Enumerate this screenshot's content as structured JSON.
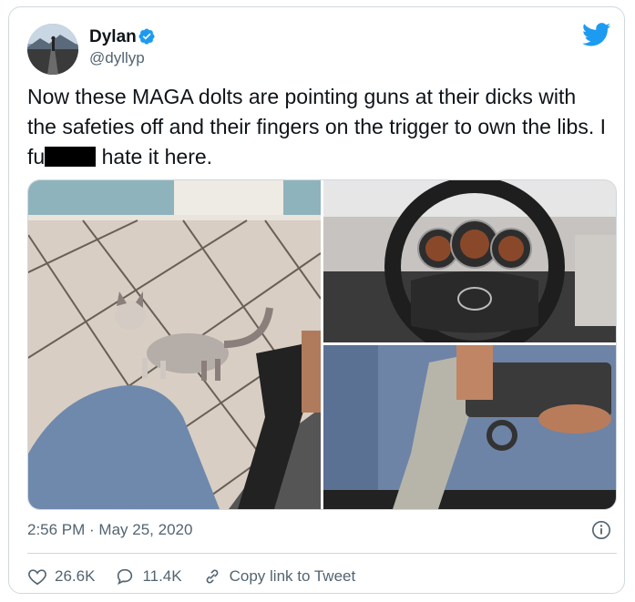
{
  "user": {
    "display_name": "Dylan",
    "handle": "@dyllyp",
    "avatar_icon": "avatar-photo",
    "verified_icon": "verified-badge-icon"
  },
  "tweet": {
    "text_part1": "Now these MAGA dolts are pointing guns at their dicks with the safeties off and their fingers on the trigger to own the libs. I fu",
    "text_part2": " hate it here.",
    "timestamp": "2:56 PM · May 25, 2020"
  },
  "media": {
    "images": [
      "cat-photo",
      "steering-wheel-photo",
      "pistol-photo"
    ]
  },
  "actions": {
    "likes": "26.6K",
    "replies": "11.4K",
    "copy_link_label": "Copy link to Tweet"
  },
  "colors": {
    "brand": "#1d9bf0",
    "text": "#0f1419",
    "muted": "#536471",
    "border": "#cfd9de"
  }
}
